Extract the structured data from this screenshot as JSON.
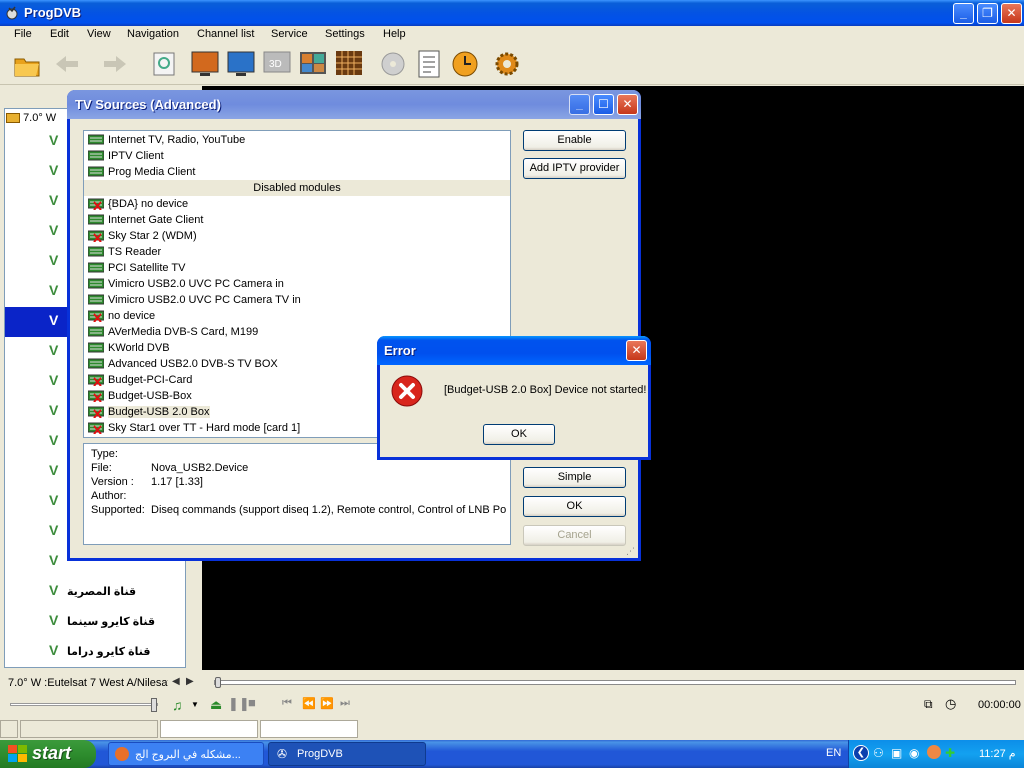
{
  "main_window": {
    "title": "ProgDVB",
    "menu": [
      "File",
      "Edit",
      "View",
      "Navigation",
      "Channel list",
      "Service",
      "Settings",
      "Help"
    ]
  },
  "channel_panel": {
    "root_label": "7.0° W",
    "channels": [
      "",
      "",
      "",
      "",
      "",
      "",
      "",
      "",
      "",
      "",
      "",
      "",
      "",
      "",
      "",
      "قناة المصرية",
      "قناة كايرو سينما",
      "قناة كايرو دراما"
    ],
    "selected_index": 6,
    "status_text": "7.0° W :Eutelsat 7 West A/Nilesat"
  },
  "player": {
    "time": "00:00:00"
  },
  "tv_sources": {
    "title": "TV Sources (Advanced)",
    "enabled_modules": [
      "Internet TV, Radio, YouTube",
      "IPTV Client",
      "Prog Media Client"
    ],
    "disabled_header": "Disabled modules",
    "disabled_modules": [
      {
        "label": "{BDA} no device",
        "error": true
      },
      {
        "label": "Internet Gate Client",
        "error": false
      },
      {
        "label": "Sky Star 2 (WDM)",
        "error": true
      },
      {
        "label": "TS Reader",
        "error": false
      },
      {
        "label": "PCI Satellite TV",
        "error": false
      },
      {
        "label": "Vimicro USB2.0 UVC PC Camera in",
        "error": false
      },
      {
        "label": "Vimicro USB2.0 UVC PC Camera TV in",
        "error": false
      },
      {
        "label": "no device",
        "error": true
      },
      {
        "label": "AVerMedia DVB-S Card, M199",
        "error": false
      },
      {
        "label": "KWorld DVB",
        "error": false
      },
      {
        "label": "Advanced USB2.0 DVB-S TV BOX",
        "error": false
      },
      {
        "label": "Budget-PCI-Card",
        "error": true
      },
      {
        "label": "Budget-USB-Box",
        "error": true
      },
      {
        "label": "Budget-USB 2.0 Box",
        "error": true
      },
      {
        "label": "Sky Star1 over TT - Hard mode [card 1]",
        "error": true
      }
    ],
    "info": {
      "type_label": "Type:",
      "file_label": "File:",
      "file_value": "Nova_USB2.Device",
      "version_label": "Version :",
      "version_value": "1.17 [1.33]",
      "author_label": "Author:",
      "supported_label": "Supported:",
      "supported_value": "Diseq commands (support diseq 1.2), Remote control, Control of LNB Po..."
    },
    "buttons": {
      "enable": "Enable",
      "add_iptv": "Add IPTV provider",
      "simple": "Simple",
      "ok": "OK",
      "cancel": "Cancel"
    }
  },
  "error_dialog": {
    "title": "Error",
    "message": "[Budget-USB 2.0 Box] Device not started!",
    "ok": "OK"
  },
  "taskbar": {
    "start": "start",
    "tasks": [
      "مشكله في البروج الج...",
      "ProgDVB"
    ],
    "lang": "EN",
    "clock": "11:27 م"
  }
}
